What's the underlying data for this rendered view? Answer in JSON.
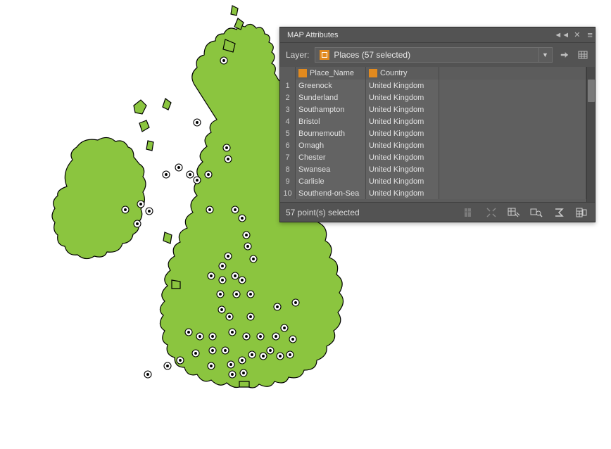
{
  "panel": {
    "title": "MAP Attributes",
    "layer_label": "Layer:",
    "layer_value": "Places (57 selected)"
  },
  "columns": {
    "row": "",
    "place": "Place_Name",
    "country": "Country"
  },
  "rows": [
    {
      "n": "1",
      "place": "Greenock",
      "country": "United Kingdom"
    },
    {
      "n": "2",
      "place": "Sunderland",
      "country": "United Kingdom"
    },
    {
      "n": "3",
      "place": "Southampton",
      "country": "United Kingdom"
    },
    {
      "n": "4",
      "place": "Bristol",
      "country": "United Kingdom"
    },
    {
      "n": "5",
      "place": "Bournemouth",
      "country": "United Kingdom"
    },
    {
      "n": "6",
      "place": "Omagh",
      "country": "United Kingdom"
    },
    {
      "n": "7",
      "place": "Chester",
      "country": "United Kingdom"
    },
    {
      "n": "8",
      "place": "Swansea",
      "country": "United Kingdom"
    },
    {
      "n": "9",
      "place": "Carlisle",
      "country": "United Kingdom"
    },
    {
      "n": "10",
      "place": "Southend-on-Sea",
      "country": "United Kingdom"
    }
  ],
  "status": {
    "text": "57 point(s) selected"
  },
  "glyphs": {
    "collapse": "◄◄",
    "close": "✕",
    "menu": "≡",
    "caret": "▼"
  }
}
